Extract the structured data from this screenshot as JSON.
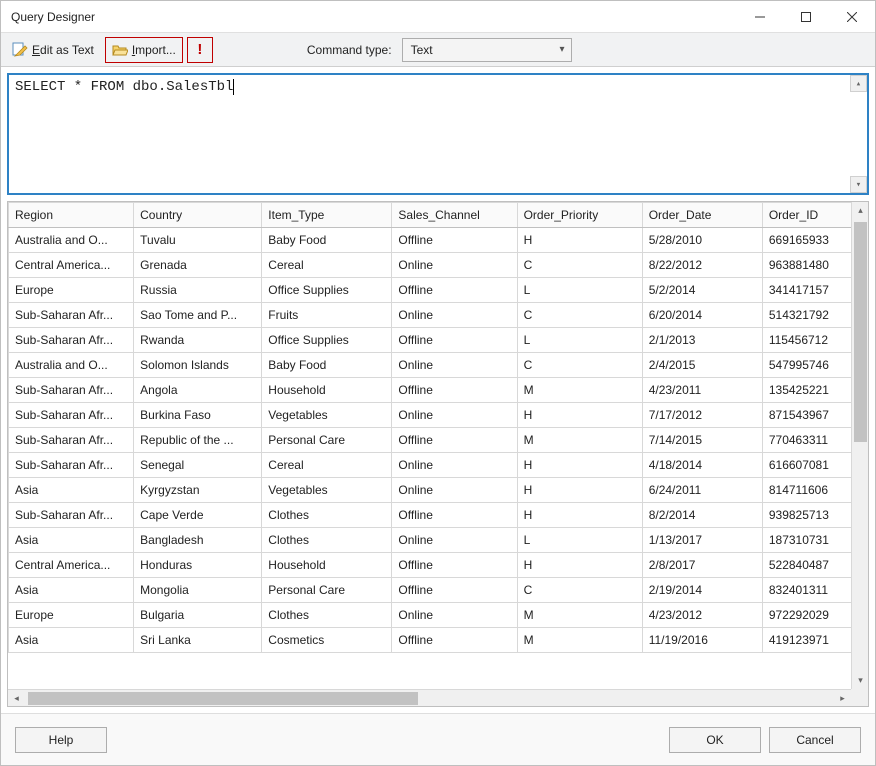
{
  "window": {
    "title": "Query Designer"
  },
  "toolbar": {
    "edit_as_text": "Edit as Text",
    "import": "Import...",
    "command_type_label": "Command type:",
    "command_type_value": "Text"
  },
  "query": {
    "text": "SELECT * FROM dbo.SalesTbl"
  },
  "grid": {
    "columns": [
      "Region",
      "Country",
      "Item_Type",
      "Sales_Channel",
      "Order_Priority",
      "Order_Date",
      "Order_ID"
    ],
    "rows": [
      [
        "Australia and O...",
        "Tuvalu",
        "Baby Food",
        "Offline",
        "H",
        "5/28/2010",
        "669165933"
      ],
      [
        "Central America...",
        "Grenada",
        "Cereal",
        "Online",
        "C",
        "8/22/2012",
        "963881480"
      ],
      [
        "Europe",
        "Russia",
        "Office Supplies",
        "Offline",
        "L",
        "5/2/2014",
        "341417157"
      ],
      [
        "Sub-Saharan Afr...",
        "Sao Tome and P...",
        "Fruits",
        "Online",
        "C",
        "6/20/2014",
        "514321792"
      ],
      [
        "Sub-Saharan Afr...",
        "Rwanda",
        "Office Supplies",
        "Offline",
        "L",
        "2/1/2013",
        "115456712"
      ],
      [
        "Australia and O...",
        "Solomon Islands",
        "Baby Food",
        "Online",
        "C",
        "2/4/2015",
        "547995746"
      ],
      [
        "Sub-Saharan Afr...",
        "Angola",
        "Household",
        "Offline",
        "M",
        "4/23/2011",
        "135425221"
      ],
      [
        "Sub-Saharan Afr...",
        "Burkina Faso",
        "Vegetables",
        "Online",
        "H",
        "7/17/2012",
        "871543967"
      ],
      [
        "Sub-Saharan Afr...",
        "Republic of the ...",
        "Personal Care",
        "Offline",
        "M",
        "7/14/2015",
        "770463311"
      ],
      [
        "Sub-Saharan Afr...",
        "Senegal",
        "Cereal",
        "Online",
        "H",
        "4/18/2014",
        "616607081"
      ],
      [
        "Asia",
        "Kyrgyzstan",
        "Vegetables",
        "Online",
        "H",
        "6/24/2011",
        "814711606"
      ],
      [
        "Sub-Saharan Afr...",
        "Cape Verde",
        "Clothes",
        "Offline",
        "H",
        "8/2/2014",
        "939825713"
      ],
      [
        "Asia",
        "Bangladesh",
        "Clothes",
        "Online",
        "L",
        "1/13/2017",
        "187310731"
      ],
      [
        "Central America...",
        "Honduras",
        "Household",
        "Offline",
        "H",
        "2/8/2017",
        "522840487"
      ],
      [
        "Asia",
        "Mongolia",
        "Personal Care",
        "Offline",
        "C",
        "2/19/2014",
        "832401311"
      ],
      [
        "Europe",
        "Bulgaria",
        "Clothes",
        "Online",
        "M",
        "4/23/2012",
        "972292029"
      ],
      [
        "Asia",
        "Sri Lanka",
        "Cosmetics",
        "Offline",
        "M",
        "11/19/2016",
        "419123971"
      ]
    ]
  },
  "footer": {
    "help": "Help",
    "ok": "OK",
    "cancel": "Cancel"
  }
}
